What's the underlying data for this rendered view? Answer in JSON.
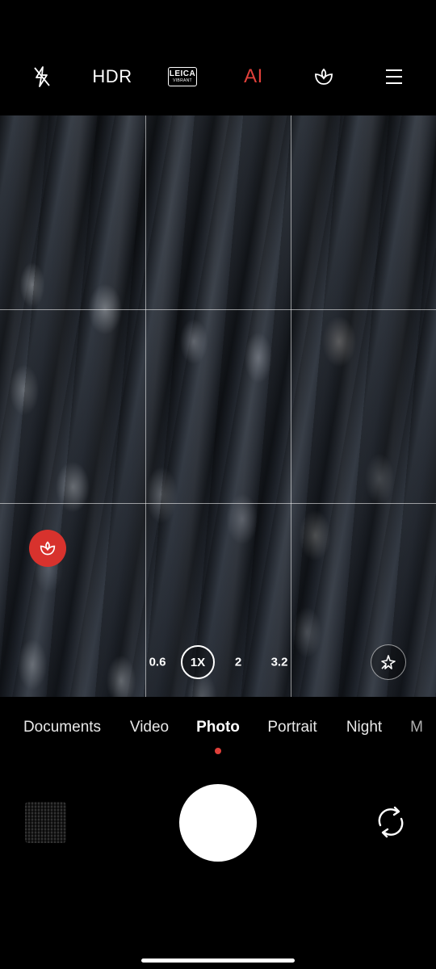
{
  "topbar": {
    "flash_icon": "flash-off-icon",
    "hdr_label": "HDR",
    "leica": {
      "line1": "LEICA",
      "line2": "VIBRANT"
    },
    "ai_label": "AI",
    "ai_color": "#e0403a",
    "beauty_icon": "beauty-icon",
    "menu_icon": "menu-icon"
  },
  "viewfinder": {
    "ai_bubble_icon": "beauty-icon",
    "ai_bubble_color": "#d8322d",
    "zoom_levels": [
      "0.6",
      "1X",
      "2",
      "3.2"
    ],
    "zoom_active": "1X",
    "magic_icon": "sparkle-icon"
  },
  "modes": {
    "items": [
      "Documents",
      "Video",
      "Photo",
      "Portrait",
      "Night",
      "M"
    ],
    "active": "Photo",
    "indicator_color": "#e0403a"
  },
  "controls": {
    "gallery_thumbnail": "gallery-thumbnail",
    "shutter": "shutter-button",
    "flip_icon": "flip-camera-icon"
  }
}
